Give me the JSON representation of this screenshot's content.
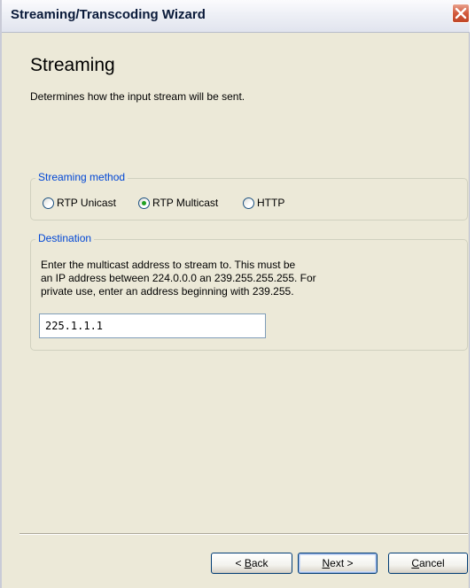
{
  "window": {
    "title": "Streaming/Transcoding Wizard"
  },
  "page": {
    "heading": "Streaming",
    "description": "Determines how the input stream will be sent."
  },
  "streaming_method": {
    "legend": "Streaming method",
    "options": [
      {
        "label": "RTP Unicast",
        "selected": false
      },
      {
        "label": "RTP Multicast",
        "selected": true
      },
      {
        "label": "HTTP",
        "selected": false
      }
    ],
    "selected_value": "RTP Multicast"
  },
  "destination": {
    "legend": "Destination",
    "description_lines": [
      "Enter the multicast address to stream to. This must be",
      "an IP address between 224.0.0.0 an 239.255.255.255. For",
      "private use, enter an address beginning with 239.255."
    ],
    "address_value": "225.1.1.1"
  },
  "buttons": {
    "back": {
      "before": "< ",
      "mnemonic": "B",
      "after": "ack"
    },
    "next": {
      "mnemonic": "N",
      "after": "ext >"
    },
    "cancel": {
      "mnemonic": "C",
      "after": "ancel"
    }
  },
  "icons": {
    "close": "close-x-icon",
    "radio": "radio-button-icon"
  },
  "colors": {
    "legend_text": "#0046d5",
    "radio_selected_dot": "#21a121",
    "close_button": "#d2593c",
    "button_border": "#003c74"
  }
}
